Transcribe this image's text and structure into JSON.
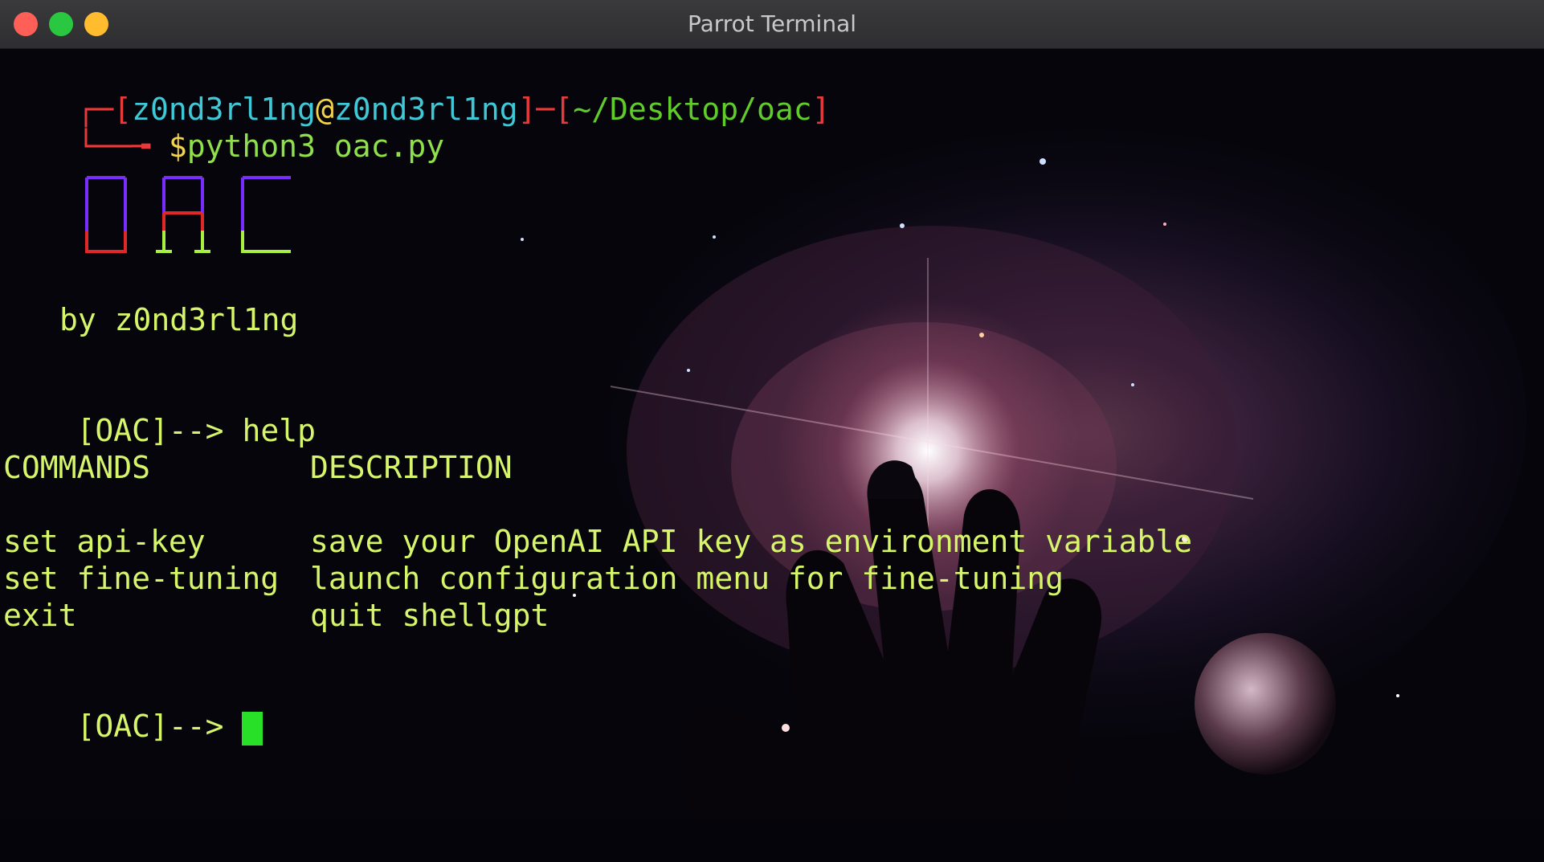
{
  "window": {
    "title": "Parrot Terminal"
  },
  "prompt": {
    "user": "z0nd3rl1ng",
    "at": "@",
    "host": "z0nd3rl1ng",
    "path": "~/Desktop/oac",
    "symbol": "$",
    "command": "python3 oac.py"
  },
  "banner": {
    "byline": "by z0nd3rl1ng"
  },
  "session": {
    "prompt_label": "[OAC]",
    "arrow": "-->",
    "first_input": "help",
    "header_commands": "COMMANDS",
    "header_description": "DESCRIPTION",
    "rows": [
      {
        "command": "set api-key",
        "description": "save your OpenAI API key as environment variable"
      },
      {
        "command": "set fine-tuning",
        "description": "launch configuration menu for fine-tuning"
      },
      {
        "command": "exit",
        "description": "quit shellgpt"
      }
    ]
  },
  "colors": {
    "terminal_text": "#d6f56a",
    "prompt_red": "#e83a3a",
    "prompt_cyan": "#3fc8d6",
    "prompt_green": "#5fcc2a",
    "cursor": "#28e028"
  }
}
